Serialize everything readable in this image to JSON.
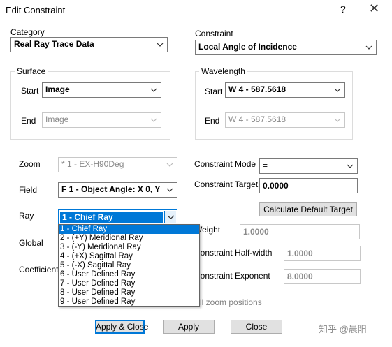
{
  "window": {
    "title": "Edit Constraint",
    "help_label": "?",
    "close_label": "✕"
  },
  "category": {
    "label": "Category",
    "value": "Real Ray Trace Data"
  },
  "constraint": {
    "label": "Constraint",
    "value": "Local Angle of Incidence"
  },
  "surface": {
    "group_label": "Surface",
    "start_label": "Start",
    "start_value": "Image",
    "end_label": "End",
    "end_value": "Image"
  },
  "wavelength": {
    "group_label": "Wavelength",
    "start_label": "Start",
    "start_value": "W 4 - 587.5618",
    "end_label": "End",
    "end_value": "W 4 - 587.5618"
  },
  "zoom": {
    "label": "Zoom",
    "value": "* 1 - EX-H90Deg"
  },
  "field": {
    "label": "Field",
    "value": "F 1 - Object Angle: X 0, Y"
  },
  "ray": {
    "label": "Ray",
    "value": "1 - Chief Ray",
    "options": [
      "1 - Chief Ray",
      "2 - (+Y) Meridional Ray",
      "3 - (-Y) Meridional Ray",
      "4 - (+X) Sagittal Ray",
      "5 - (-X) Sagittal Ray",
      "6 - User Defined Ray",
      "7 - User Defined Ray",
      "8 - User Defined Ray",
      "9 - User Defined Ray"
    ]
  },
  "global_label": "Global",
  "coefficient_label": "Coefficient",
  "constraint_mode": {
    "label": "Constraint Mode",
    "value": "="
  },
  "constraint_target": {
    "label": "Constraint Target",
    "value": "0.0000"
  },
  "calc_default_target_label": "Calculate Default Target",
  "weight": {
    "label": "Weight",
    "value": "1.0000"
  },
  "half_width": {
    "label": "Constraint Half-width",
    "value": "1.0000"
  },
  "exponent": {
    "label": "Constraint Exponent",
    "value": "8.0000"
  },
  "all_zoom_label": "All zoom positions",
  "buttons": {
    "apply_close": "Apply & Close",
    "apply": "Apply",
    "close": "Close"
  },
  "watermark": "知乎 @晨阳",
  "colors": {
    "accent": "#0078d7"
  }
}
